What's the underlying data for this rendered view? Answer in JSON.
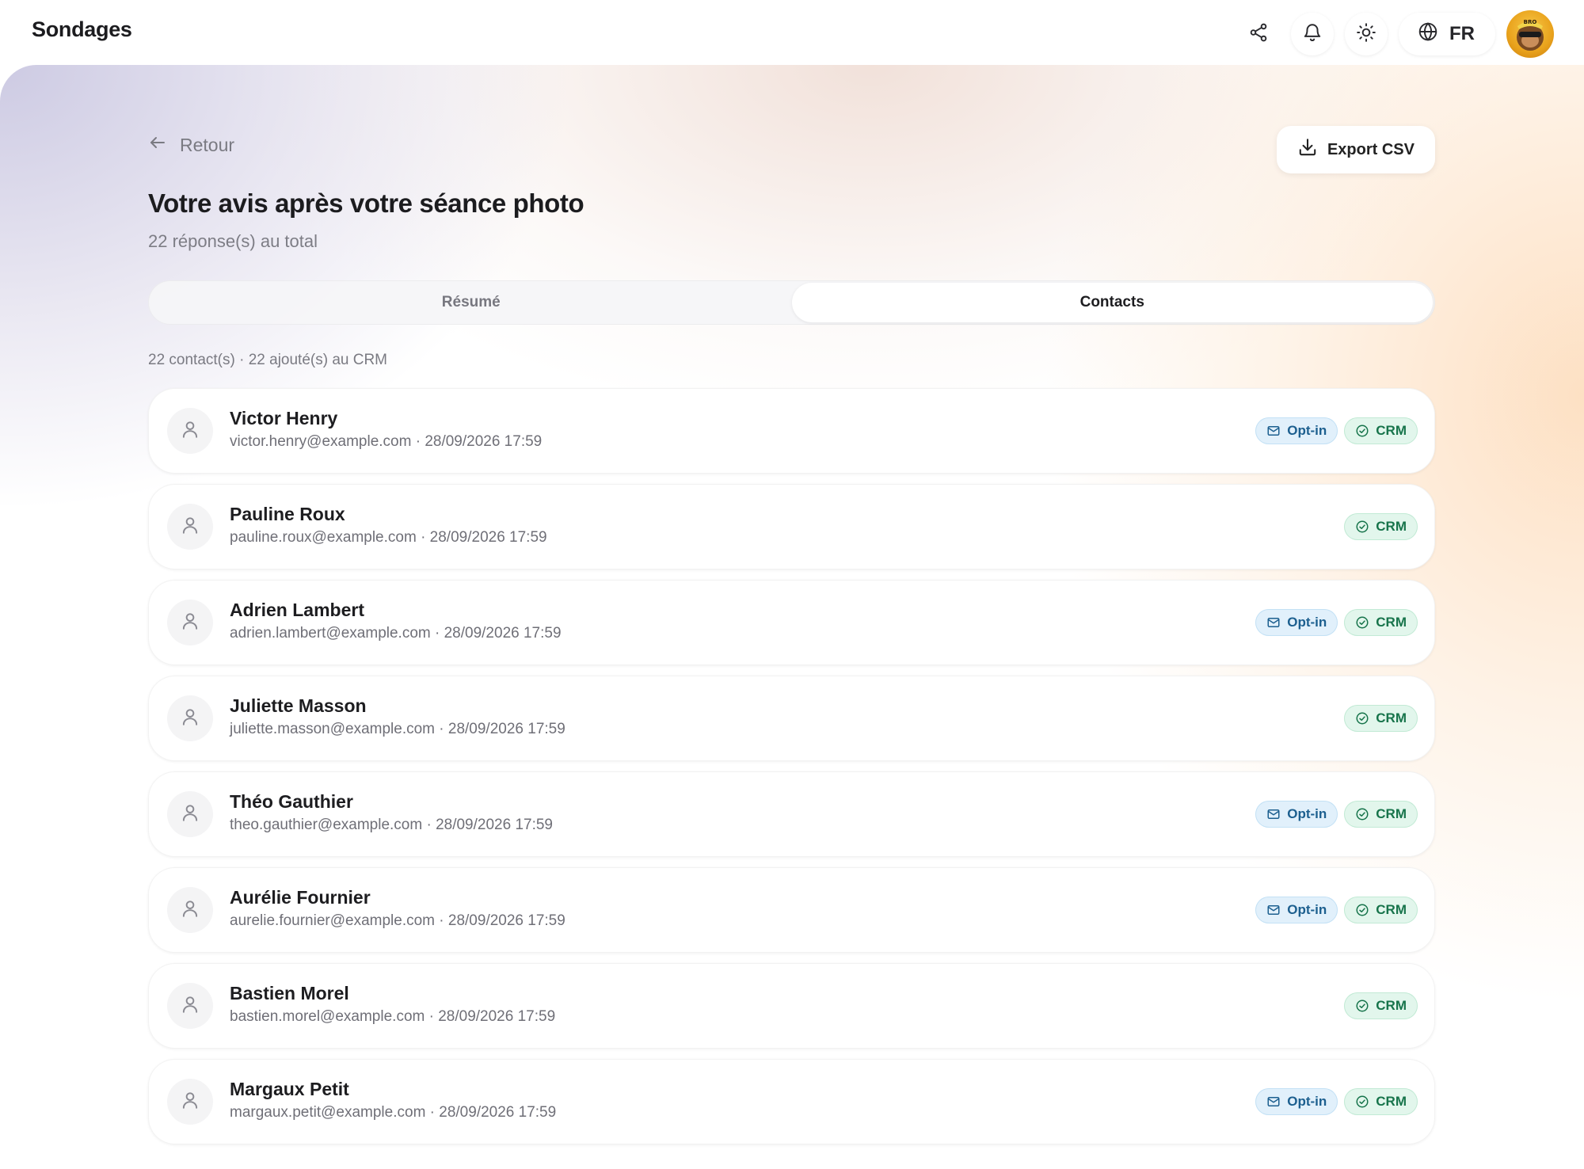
{
  "app": {
    "title": "Sondages"
  },
  "topbar": {
    "language": "FR"
  },
  "page": {
    "back_label": "Retour",
    "export_label": "Export CSV",
    "title": "Votre avis après votre séance photo",
    "subtitle": "22 réponse(s) au total",
    "tabs": [
      {
        "label": "Résumé",
        "active": false
      },
      {
        "label": "Contacts",
        "active": true
      }
    ],
    "summary": "22 contact(s) · 22 ajouté(s) au CRM"
  },
  "badges": {
    "optin_label": "Opt-in",
    "crm_label": "CRM"
  },
  "contacts": [
    {
      "name": "Victor Henry",
      "meta": "victor.henry@example.com · 28/09/2026 17:59",
      "optin": true,
      "crm": true
    },
    {
      "name": "Pauline Roux",
      "meta": "pauline.roux@example.com · 28/09/2026 17:59",
      "optin": false,
      "crm": true
    },
    {
      "name": "Adrien Lambert",
      "meta": "adrien.lambert@example.com · 28/09/2026 17:59",
      "optin": true,
      "crm": true
    },
    {
      "name": "Juliette Masson",
      "meta": "juliette.masson@example.com · 28/09/2026 17:59",
      "optin": false,
      "crm": true
    },
    {
      "name": "Théo Gauthier",
      "meta": "theo.gauthier@example.com · 28/09/2026 17:59",
      "optin": true,
      "crm": true
    },
    {
      "name": "Aurélie Fournier",
      "meta": "aurelie.fournier@example.com · 28/09/2026 17:59",
      "optin": true,
      "crm": true
    },
    {
      "name": "Bastien Morel",
      "meta": "bastien.morel@example.com · 28/09/2026 17:59",
      "optin": false,
      "crm": true
    },
    {
      "name": "Margaux Petit",
      "meta": "margaux.petit@example.com · 28/09/2026 17:59",
      "optin": true,
      "crm": true
    }
  ],
  "icons": {
    "share": "share-icon",
    "bell": "bell-icon",
    "theme": "sun-icon",
    "globe": "globe-icon",
    "back": "arrow-left-icon",
    "download": "download-icon",
    "user": "user-icon",
    "mail": "mail-icon",
    "check": "check-circle-icon"
  },
  "colors": {
    "optin_text": "#1c5f8f",
    "optin_bg": "#e1f0fb",
    "crm_text": "#17744b",
    "crm_bg": "#e2f6ec"
  }
}
